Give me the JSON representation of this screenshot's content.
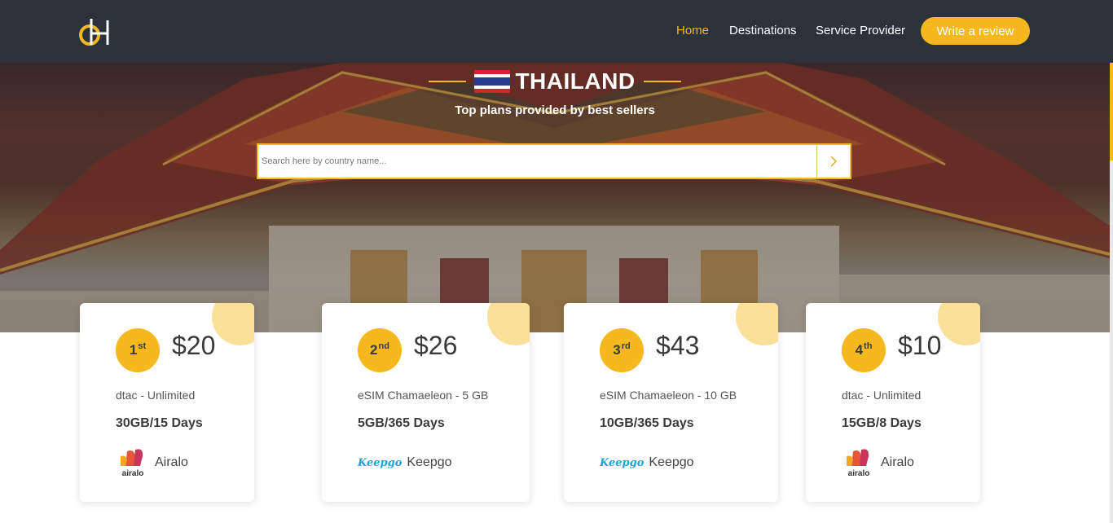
{
  "nav": {
    "home": "Home",
    "destinations": "Destinations",
    "service_provider": "Service Provider",
    "write_review": "Write a review"
  },
  "hero": {
    "country": "THAILAND",
    "subtitle": "Top plans provided by best sellers",
    "search_placeholder": "Search here by country name..."
  },
  "cards": [
    {
      "rank": "1",
      "rank_suffix": "st",
      "price": "$20",
      "plan_name": "dtac - Unlimited",
      "plan_data": "30GB/15 Days",
      "provider": "Airalo",
      "logo_text": "airalo"
    },
    {
      "rank": "2",
      "rank_suffix": "nd",
      "price": "$26",
      "plan_name": "eSIM Chamaeleon - 5 GB",
      "plan_data": "5GB/365 Days",
      "provider": "Keepgo",
      "logo_text": "Keepgo"
    },
    {
      "rank": "3",
      "rank_suffix": "rd",
      "price": "$43",
      "plan_name": "eSIM Chamaeleon - 10 GB",
      "plan_data": "10GB/365 Days",
      "provider": "Keepgo",
      "logo_text": "Keepgo"
    },
    {
      "rank": "4",
      "rank_suffix": "th",
      "price": "$10",
      "plan_name": "dtac - Unlimited",
      "plan_data": "15GB/8 Days",
      "provider": "Airalo",
      "logo_text": "airalo"
    }
  ],
  "colors": {
    "header_bg": "#2b323b",
    "accent": "#f5b81e",
    "accent_light": "#fbe09a",
    "keepgo_blue": "#1aa3d6"
  },
  "icons": {
    "logo": "site-logo-icon",
    "search_submit": "chevron-right-icon",
    "flag": "thailand-flag-icon"
  }
}
